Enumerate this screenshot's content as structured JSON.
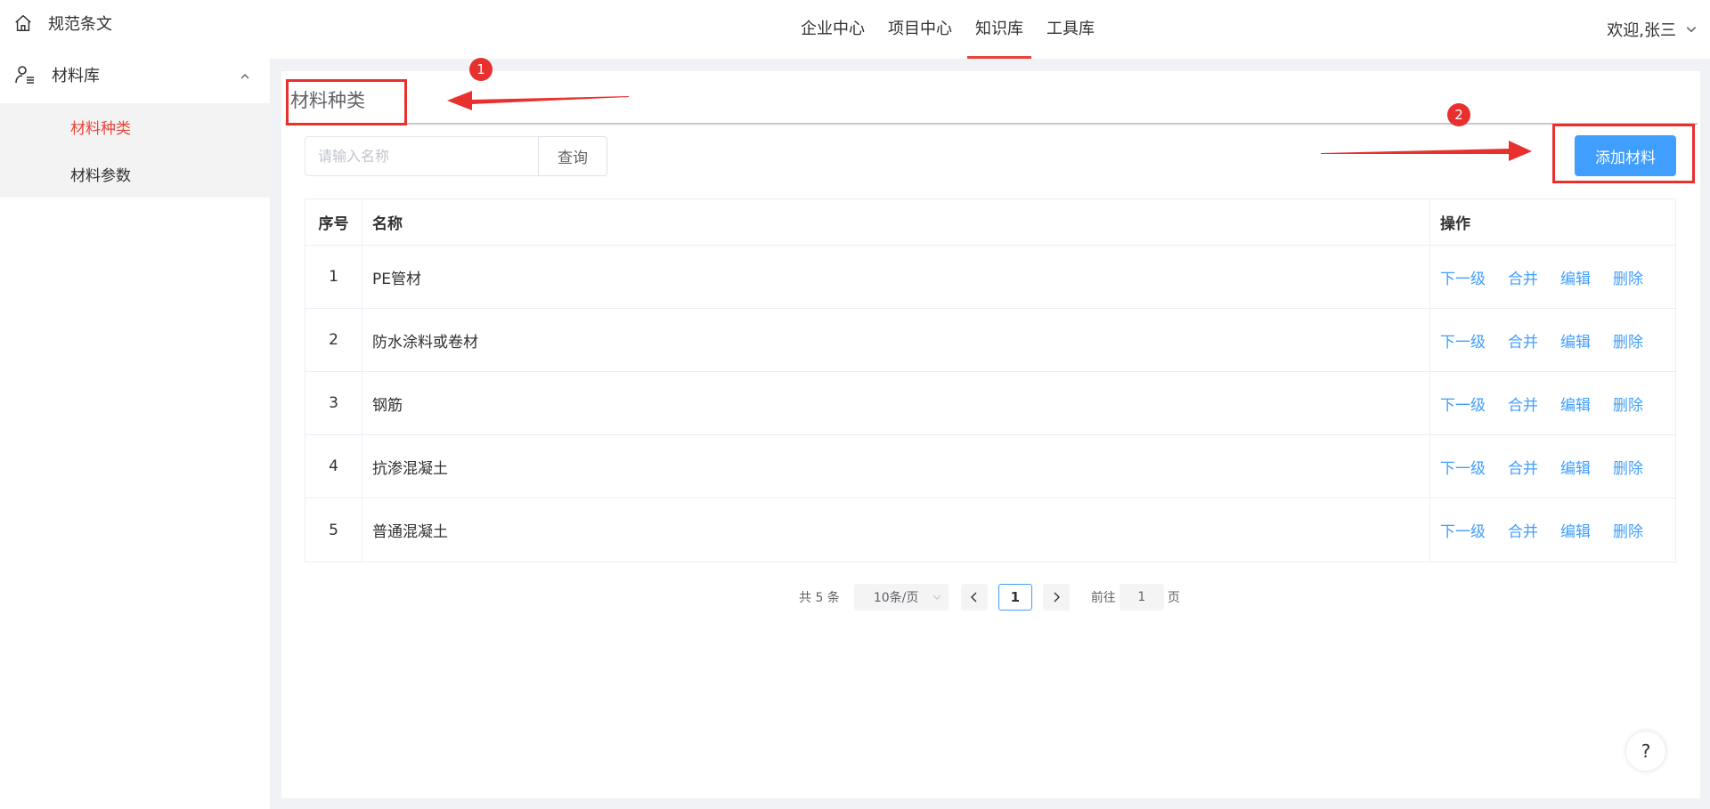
{
  "sidebar": {
    "top_item": {
      "label": "规范条文",
      "icon": "home-icon"
    },
    "group": {
      "label": "材料库",
      "icon": "user-list-icon"
    },
    "sub_items": [
      {
        "label": "材料种类",
        "active": true
      },
      {
        "label": "材料参数",
        "active": false
      }
    ]
  },
  "topnav": {
    "items": [
      {
        "label": "企业中心",
        "active": false
      },
      {
        "label": "项目中心",
        "active": false
      },
      {
        "label": "知识库",
        "active": true
      },
      {
        "label": "工具库",
        "active": false
      }
    ],
    "user": "欢迎,张三"
  },
  "page": {
    "title": "材料种类",
    "search": {
      "placeholder": "请输入名称",
      "value": "",
      "button": "查询"
    },
    "add_button": "添加材料"
  },
  "table": {
    "headers": {
      "index": "序号",
      "name": "名称",
      "ops": "操作"
    },
    "rows": [
      {
        "index": "1",
        "name": "PE管材"
      },
      {
        "index": "2",
        "name": "防水涂料或卷材"
      },
      {
        "index": "3",
        "name": "钢筋"
      },
      {
        "index": "4",
        "name": "抗渗混凝土"
      },
      {
        "index": "5",
        "name": "普通混凝土"
      }
    ],
    "ops": [
      "下一级",
      "合并",
      "编辑",
      "删除"
    ]
  },
  "pagination": {
    "total": "共 5 条",
    "page_size": "10条/页",
    "current": "1",
    "goto_label": "前往",
    "goto_value": "1",
    "page_suffix": "页"
  },
  "help": "?",
  "annotations": {
    "badge1": "1",
    "badge2": "2"
  },
  "colors": {
    "accent": "#e8443a",
    "primary": "#409eff",
    "annotation": "#e8312f"
  }
}
